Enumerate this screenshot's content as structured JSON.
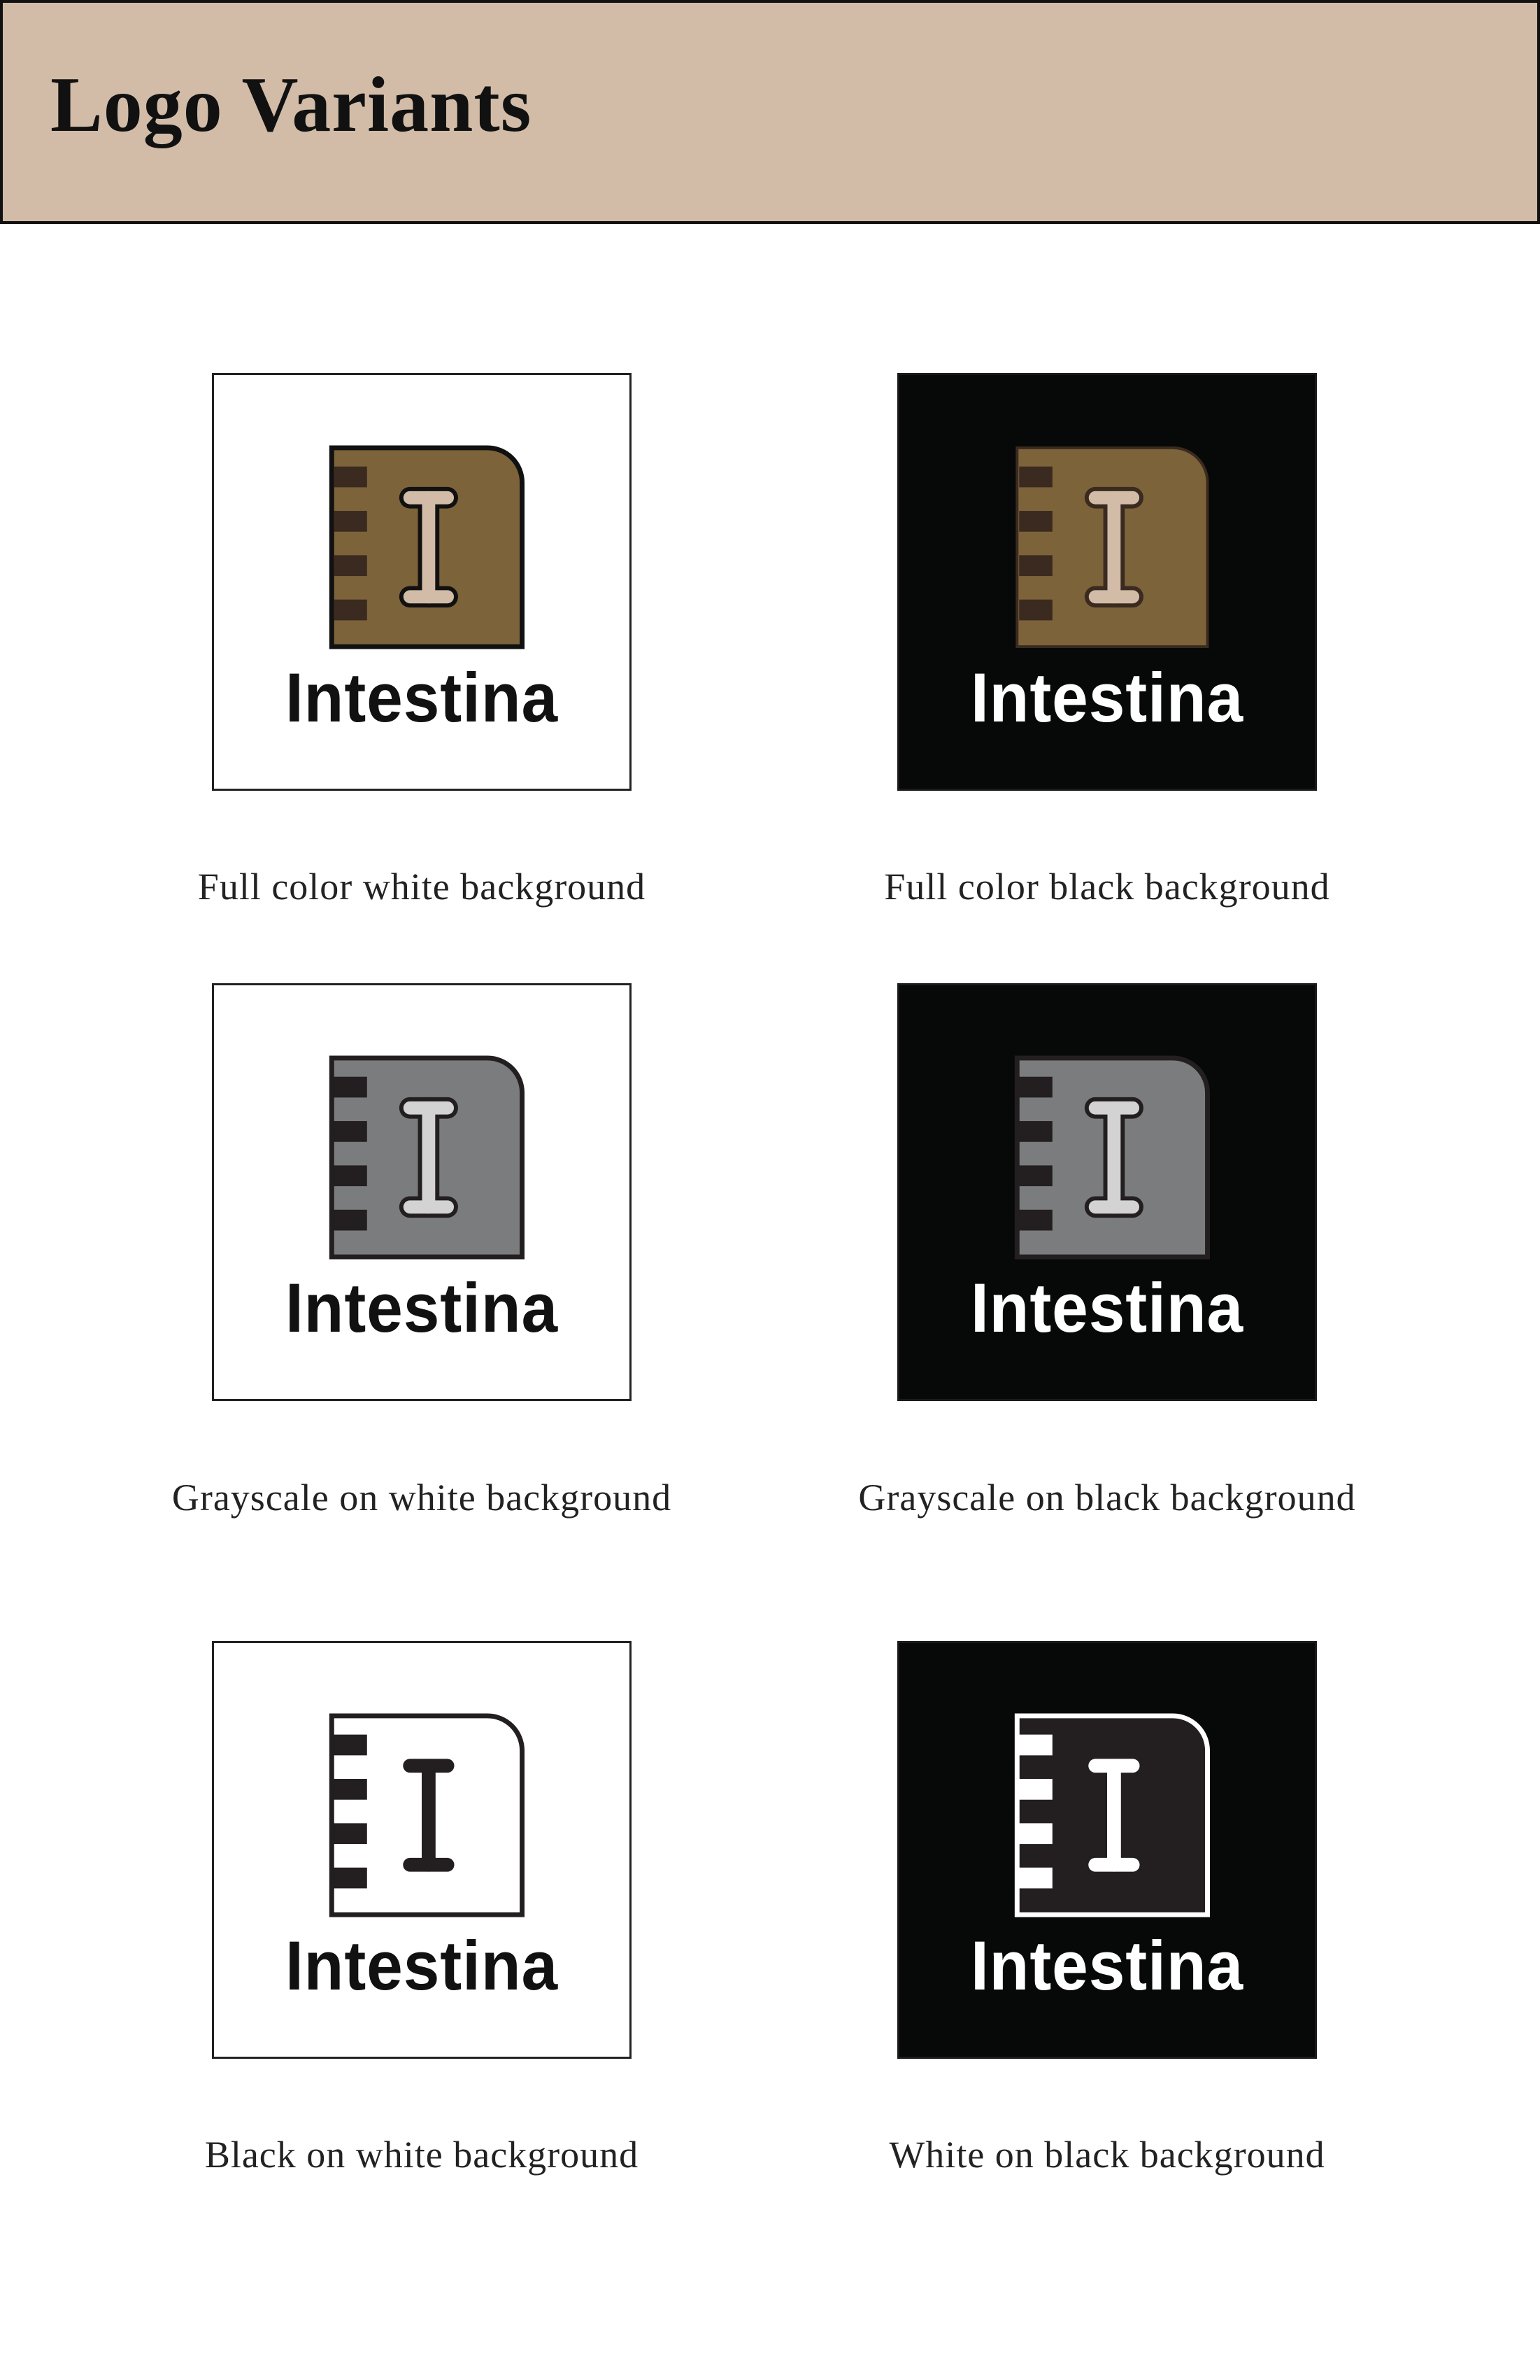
{
  "header": {
    "title": "Logo Variants",
    "background": "#d2bca8"
  },
  "brand": {
    "wordmark": "Intestina",
    "icon": "notebook-i-icon"
  },
  "variants": [
    {
      "id": "full-color-white",
      "caption": "Full color white background",
      "background": "#ffffff",
      "colors": {
        "body": "#7d633a",
        "tabs": "#3a2a1f",
        "letter": "#d2bca8",
        "outline": "#111111",
        "wordmark": "#111111"
      }
    },
    {
      "id": "full-color-black",
      "caption": "Full color black background",
      "background": "#070808",
      "colors": {
        "body": "#7d633a",
        "tabs": "#3a2a1f",
        "letter": "#d2bca8",
        "outline": "#3a2a1f",
        "wordmark": "#ffffff"
      }
    },
    {
      "id": "grayscale-white",
      "caption": "Grayscale on white background",
      "background": "#ffffff",
      "colors": {
        "body": "#7b7c7e",
        "tabs": "#231f20",
        "letter": "#d3d3d3",
        "outline": "#231f20",
        "wordmark": "#111111"
      }
    },
    {
      "id": "grayscale-black",
      "caption": "Grayscale on black background",
      "background": "#070808",
      "colors": {
        "body": "#7b7c7e",
        "tabs": "#231f20",
        "letter": "#d3d3d3",
        "outline": "#231f20",
        "wordmark": "#ffffff"
      }
    },
    {
      "id": "black-on-white",
      "caption": "Black on white background",
      "background": "#ffffff",
      "colors": {
        "body": "#ffffff",
        "tabs": "#231f20",
        "letter": "#231f20",
        "outline": "#231f20",
        "wordmark": "#111111"
      }
    },
    {
      "id": "white-on-black",
      "caption": "White on black background",
      "background": "#070808",
      "colors": {
        "body": "#231f20",
        "tabs": "#ffffff",
        "letter": "#ffffff",
        "outline": "#ffffff",
        "wordmark": "#ffffff"
      }
    }
  ]
}
